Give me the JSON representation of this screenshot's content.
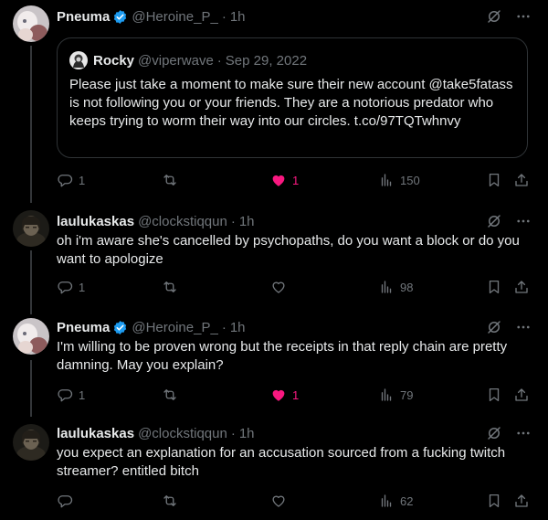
{
  "tweets": [
    {
      "name": "Pneuma",
      "verified": true,
      "handle": "@Heroine_P_",
      "separator": "·",
      "time": "1h",
      "quote": {
        "name": "Rocky",
        "handle": "@viperwave",
        "separator": "·",
        "date": "Sep 29, 2022",
        "text": "Please just take a moment to make sure their new account @take5fatass is not following you or your friends. They are a notorious predator who keeps trying to worm their way into our circles. t.co/97TQTwhnvy"
      },
      "replies": "1",
      "retweets": "",
      "likes": "1",
      "liked": true,
      "views": "150"
    },
    {
      "name": "laulukaskas",
      "verified": false,
      "handle": "@clockstiqqun",
      "separator": "·",
      "time": "1h",
      "text": "oh i'm aware she's cancelled by psychopaths, do you want a block or do you want to apologize",
      "replies": "1",
      "retweets": "",
      "likes": "",
      "liked": false,
      "views": "98"
    },
    {
      "name": "Pneuma",
      "verified": true,
      "handle": "@Heroine_P_",
      "separator": "·",
      "time": "1h",
      "text": "I'm willing to be proven wrong but the receipts in that reply chain are pretty damning. May you explain?",
      "replies": "1",
      "retweets": "",
      "likes": "1",
      "liked": true,
      "views": "79"
    },
    {
      "name": "laulukaskas",
      "verified": false,
      "handle": "@clockstiqqun",
      "separator": "·",
      "time": "1h",
      "text": "you expect an explanation for an accusation sourced from a fucking twitch streamer? entitled bitch",
      "replies": "",
      "retweets": "",
      "likes": "",
      "liked": false,
      "views": "62"
    }
  ],
  "colors": {
    "background": "#000000",
    "text_primary": "#e7e9ea",
    "text_secondary": "#71767b",
    "verified_blue": "#1d9bf0",
    "like_pink": "#f91880",
    "border": "#2f3336"
  }
}
